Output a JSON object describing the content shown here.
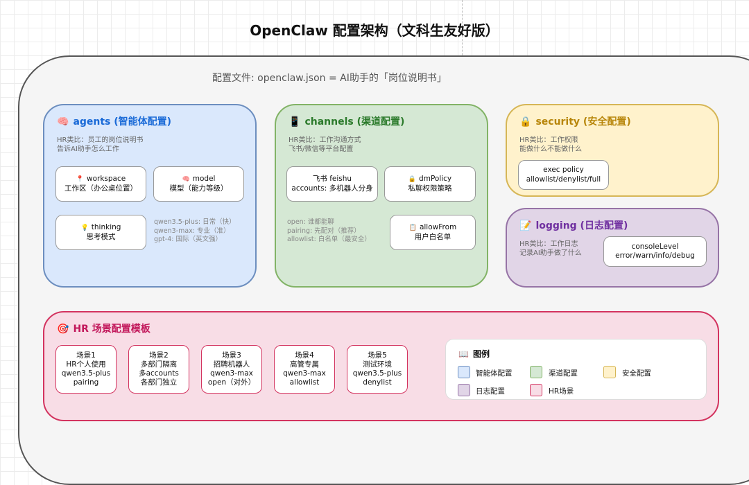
{
  "title": "OpenClaw 配置架构（文科生友好版）",
  "subtitle": "配置文件: openclaw.json = AI助手的「岗位说明书」",
  "agents": {
    "icon": "🧠",
    "title": "agents (智能体配置)",
    "desc1": "HR类比：员工的岗位说明书",
    "desc2": "告诉AI助手怎么工作",
    "workspace": {
      "icon": "📍",
      "line1": "workspace",
      "line2": "工作区（办公桌位置）"
    },
    "model": {
      "icon": "🧠",
      "line1": "model",
      "line2": "模型（能力等级）"
    },
    "thinking": {
      "icon": "💡",
      "line1": "thinking",
      "line2": "思考模式"
    },
    "notes": [
      "qwen3.5-plus: 日常（快）",
      "qwen3-max: 专业（准）",
      "gpt-4: 国际（英文强）"
    ]
  },
  "channels": {
    "icon": "📱",
    "title": "channels (渠道配置)",
    "desc1": "HR类比：工作沟通方式",
    "desc2": "飞书/微信等平台配置",
    "feishu": {
      "line1": "飞书 feishu",
      "line2": "accounts: 多机器人分身"
    },
    "dmpolicy": {
      "icon": "🔒",
      "line1": "dmPolicy",
      "line2": "私聊权限策略"
    },
    "allowfrom": {
      "icon": "📋",
      "line1": "allowFrom",
      "line2": "用户白名单"
    },
    "notes": [
      "open: 谁都能聊",
      "pairing: 先配对（推荐）",
      "allowlist: 白名单（最安全）"
    ]
  },
  "security": {
    "icon": "🔒",
    "title": "security (安全配置)",
    "desc1": "HR类比：工作权限",
    "desc2": "能做什么不能做什么",
    "exec": {
      "line1": "exec policy",
      "line2": "allowlist/denylist/full"
    }
  },
  "logging": {
    "icon": "📝",
    "title": "logging (日志配置)",
    "desc1": "HR类比：工作日志",
    "desc2": "记录AI助手做了什么",
    "console": {
      "line1": "consoleLevel",
      "line2": "error/warn/info/debug"
    }
  },
  "hr": {
    "icon": "🎯",
    "title": "HR 场景配置模板",
    "scenes": [
      {
        "l1": "场景1",
        "l2": "HR个人使用",
        "l3": "qwen3.5-plus",
        "l4": "pairing"
      },
      {
        "l1": "场景2",
        "l2": "多部门隔离",
        "l3": "多accounts",
        "l4": "各部门独立"
      },
      {
        "l1": "场景3",
        "l2": "招聘机器人",
        "l3": "qwen3-max",
        "l4": "open（对外）"
      },
      {
        "l1": "场景4",
        "l2": "高管专属",
        "l3": "qwen3-max",
        "l4": "allowlist"
      },
      {
        "l1": "场景5",
        "l2": "测试环境",
        "l3": "qwen3.5-plus",
        "l4": "denylist"
      }
    ]
  },
  "legend": {
    "icon": "📖",
    "title": "图例",
    "items": [
      {
        "label": "智能体配置",
        "fill": "#dae8fc",
        "stroke": "#6c8ebf"
      },
      {
        "label": "渠道配置",
        "fill": "#d5e8d4",
        "stroke": "#82b366"
      },
      {
        "label": "安全配置",
        "fill": "#fff2cc",
        "stroke": "#d6b656"
      },
      {
        "label": "日志配置",
        "fill": "#e1d5e7",
        "stroke": "#9673a6"
      },
      {
        "label": "HR场景",
        "fill": "#f8dde6",
        "stroke": "#d3335f"
      }
    ]
  }
}
